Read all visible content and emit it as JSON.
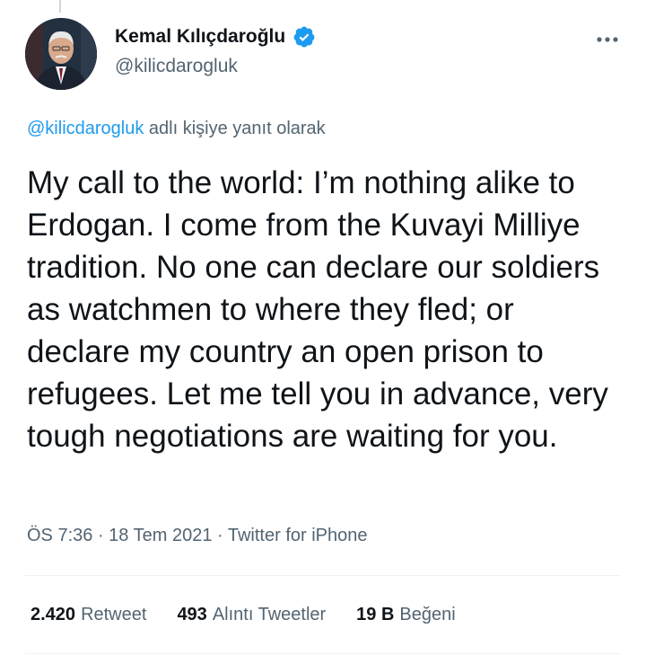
{
  "author": {
    "display_name": "Kemal Kılıçdaroğlu",
    "handle": "@kilicdarogluk",
    "verified": true
  },
  "reply_context": {
    "mention": "@kilicdarogluk",
    "suffix": " adlı kişiye yanıt olarak"
  },
  "tweet": {
    "text": "My call to the world: I’m nothing alike to Erdogan. I come from the Kuvayi Milliye tradition. No one can declare our soldiers as watchmen to where they fled; or declare my country an open prison to refugees. Let me tell you in advance, very tough negotiations are waiting for you."
  },
  "meta": {
    "time": "ÖS 7:36",
    "sep1": " · ",
    "date": "18 Tem 2021",
    "sep2": " · ",
    "source": "Twitter for iPhone"
  },
  "stats": {
    "retweets_count": "2.420",
    "retweets_label": "Retweet",
    "quotes_count": "493",
    "quotes_label": "Alıntı Tweetler",
    "likes_count": "19 B",
    "likes_label": "Beğeni"
  },
  "icons": {
    "verified": "verified-badge-icon",
    "more": "more-horizontal-icon"
  },
  "colors": {
    "accent": "#1d9bf0",
    "text": "#0f1419",
    "secondary": "#536471"
  }
}
